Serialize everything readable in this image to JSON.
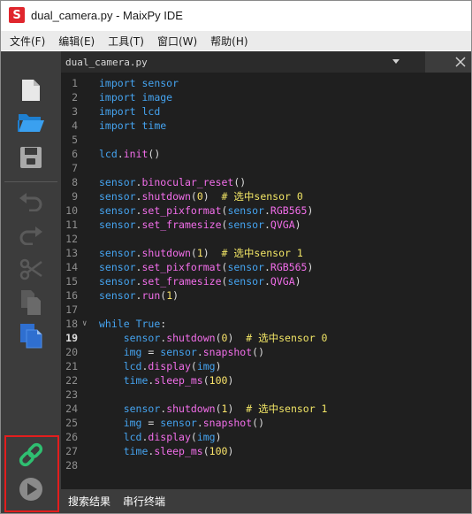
{
  "window": {
    "title": "dual_camera.py - MaixPy IDE",
    "app_icon_letter": "S"
  },
  "menubar": [
    {
      "label": "文件(F)"
    },
    {
      "label": "编辑(E)"
    },
    {
      "label": "工具(T)"
    },
    {
      "label": "窗口(W)"
    },
    {
      "label": "帮助(H)"
    }
  ],
  "toolbar": {
    "icons": [
      "new-file-icon",
      "open-folder-icon",
      "save-icon",
      "undo-icon",
      "redo-icon",
      "cut-icon",
      "copy-icon",
      "paste-icon",
      "connect-icon",
      "run-icon"
    ],
    "highlight_color": "#e31d1d"
  },
  "editor_tab": {
    "filename": "dual_camera.py"
  },
  "current_line": 19,
  "code_lines": [
    {
      "num": "1",
      "text": "import sensor"
    },
    {
      "num": "2",
      "text": "import image"
    },
    {
      "num": "3",
      "text": "import lcd"
    },
    {
      "num": "4",
      "text": "import time"
    },
    {
      "num": "5",
      "text": ""
    },
    {
      "num": "6",
      "text": "lcd.init()"
    },
    {
      "num": "7",
      "text": ""
    },
    {
      "num": "8",
      "text": "sensor.binocular_reset()"
    },
    {
      "num": "9",
      "text": "sensor.shutdown(0)  # 选中sensor 0"
    },
    {
      "num": "10",
      "text": "sensor.set_pixformat(sensor.RGB565)"
    },
    {
      "num": "11",
      "text": "sensor.set_framesize(sensor.QVGA)"
    },
    {
      "num": "12",
      "text": ""
    },
    {
      "num": "13",
      "text": "sensor.shutdown(1)  # 选中sensor 1"
    },
    {
      "num": "14",
      "text": "sensor.set_pixformat(sensor.RGB565)"
    },
    {
      "num": "15",
      "text": "sensor.set_framesize(sensor.QVGA)"
    },
    {
      "num": "16",
      "text": "sensor.run(1)"
    },
    {
      "num": "17",
      "text": ""
    },
    {
      "num": "18",
      "text": "while True:"
    },
    {
      "num": "19",
      "text": "    sensor.shutdown(0)  # 选中sensor 0"
    },
    {
      "num": "20",
      "text": "    img = sensor.snapshot()"
    },
    {
      "num": "21",
      "text": "    lcd.display(img)"
    },
    {
      "num": "22",
      "text": "    time.sleep_ms(100)"
    },
    {
      "num": "23",
      "text": ""
    },
    {
      "num": "24",
      "text": "    sensor.shutdown(1)  # 选中sensor 1"
    },
    {
      "num": "25",
      "text": "    img = sensor.snapshot()"
    },
    {
      "num": "26",
      "text": "    lcd.display(img)"
    },
    {
      "num": "27",
      "text": "    time.sleep_ms(100)"
    },
    {
      "num": "28",
      "text": ""
    }
  ],
  "bottom_panel": {
    "tabs": [
      {
        "label": "搜索结果"
      },
      {
        "label": "串行终端"
      }
    ]
  },
  "colors": {
    "keyword": "#45a3ef",
    "function": "#f26eea",
    "number": "#f9e36a",
    "comment": "#f0e465",
    "editor_bg": "#1f1f1f",
    "toolbar_bg": "#3c3c3c",
    "connect_icon": "#2fbf71"
  }
}
